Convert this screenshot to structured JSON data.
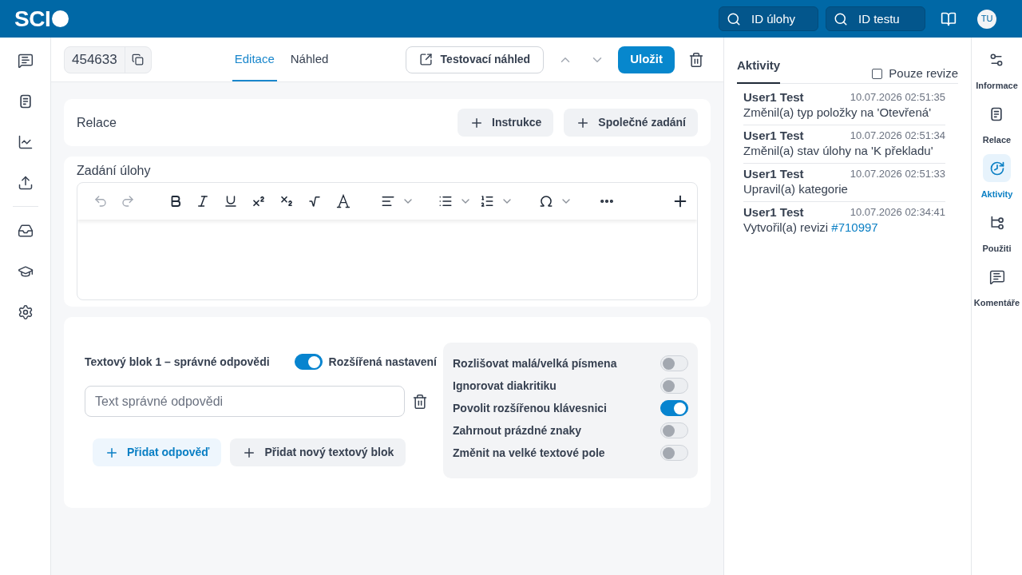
{
  "header": {
    "logo": "SCI",
    "search_fields": [
      {
        "placeholder": "ID úlohy"
      },
      {
        "placeholder": "ID testu"
      }
    ],
    "avatar": "TU"
  },
  "toolbar": {
    "item_id": "454633",
    "tabs": [
      {
        "label": "Editace",
        "selected": true
      },
      {
        "label": "Náhled",
        "selected": false
      }
    ],
    "preview_button": "Testovací náhled",
    "save_button": "Uložit"
  },
  "relations": {
    "title": "Relace",
    "buttons": [
      "Instrukce",
      "Společné zadání"
    ]
  },
  "task": {
    "title": "Zadání úlohy"
  },
  "answers": {
    "block_label": "Textový blok 1 – správné odpovědi",
    "advanced": {
      "label": "Rozšířená nastavení",
      "on": true
    },
    "fields": [
      {
        "placeholder": "Text správné odpovědi"
      }
    ],
    "add_answer": "Přidat odpověď",
    "add_block": "Přidat nový textový blok",
    "options": [
      {
        "label": "Rozlišovat malá/velká písmena",
        "on": false
      },
      {
        "label": "Ignorovat diakritiku",
        "on": false
      },
      {
        "label": "Povolit rozšířenou klávesnici",
        "on": true
      },
      {
        "label": "Zahrnout prázdné znaky",
        "on": false
      },
      {
        "label": "Změnit na velké textové pole",
        "on": false
      }
    ]
  },
  "activity": {
    "tabs": [
      {
        "label": "Aktivity",
        "selected": true
      }
    ],
    "filter": {
      "label": "Pouze revize",
      "checked": false
    },
    "entries": [
      {
        "user": "User1 Test",
        "time": "10.07.2026 02:51:35",
        "text": "Změnil(a) typ položky na 'Otevřená'"
      },
      {
        "user": "User1 Test",
        "time": "10.07.2026 02:51:34",
        "text": "Změnil(a) stav úlohy na 'K překladu'"
      },
      {
        "user": "User1 Test",
        "time": "10.07.2026 02:51:33",
        "text": "Upravil(a) kategorie"
      },
      {
        "user": "User1 Test",
        "time": "10.07.2026 02:34:41",
        "text": "Vytvořil(a) revizi",
        "link": "#710997"
      }
    ]
  },
  "side_rail": [
    {
      "label": "Informace",
      "selected": false
    },
    {
      "label": "Relace",
      "selected": false
    },
    {
      "label": "Aktivity",
      "selected": true
    },
    {
      "label": "Použiti",
      "selected": false
    },
    {
      "label": "Komentáře",
      "selected": false
    }
  ]
}
